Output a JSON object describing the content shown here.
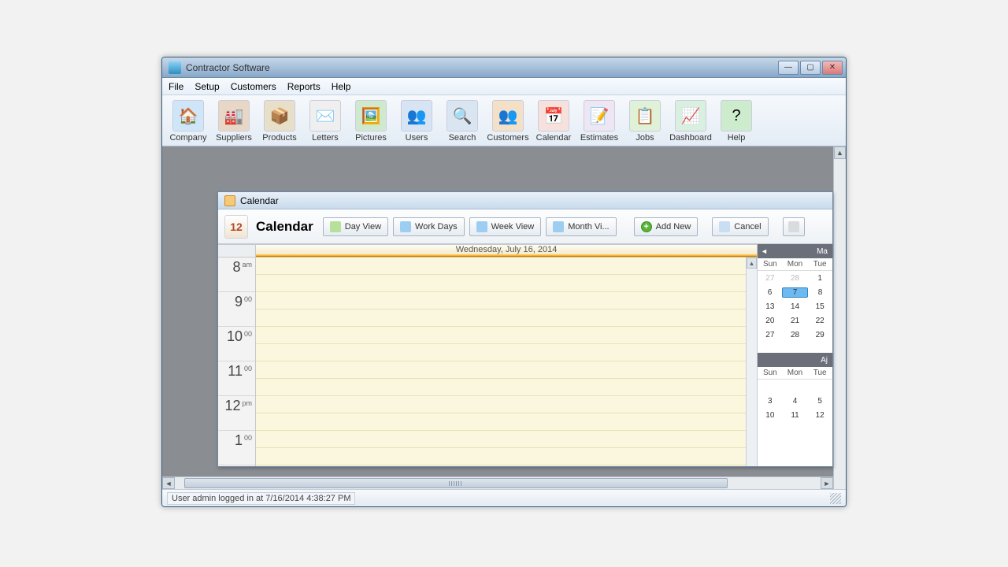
{
  "window": {
    "title": "Contractor Software"
  },
  "menubar": [
    "File",
    "Setup",
    "Customers",
    "Reports",
    "Help"
  ],
  "toolbar": [
    {
      "label": "Company",
      "icon": "house-icon",
      "glyph": "🏠",
      "bg": "#cfe6f9"
    },
    {
      "label": "Suppliers",
      "icon": "factory-icon",
      "glyph": "🏭",
      "bg": "#e9d7c6"
    },
    {
      "label": "Products",
      "icon": "box-icon",
      "glyph": "📦",
      "bg": "#e8dfc9"
    },
    {
      "label": "Letters",
      "icon": "envelope-icon",
      "glyph": "✉️",
      "bg": "#efeff0"
    },
    {
      "label": "Pictures",
      "icon": "photo-icon",
      "glyph": "🖼️",
      "bg": "#cfe9cf"
    },
    {
      "label": "Users",
      "icon": "users-icon",
      "glyph": "👥",
      "bg": "#d6e4f3"
    },
    {
      "label": "Search",
      "icon": "search-icon",
      "glyph": "🔍",
      "bg": "#d9e6f2"
    },
    {
      "label": "Customers",
      "icon": "people-icon",
      "glyph": "👥",
      "bg": "#f4e0c7"
    },
    {
      "label": "Calendar",
      "icon": "calendar-icon",
      "glyph": "📅",
      "bg": "#f7e1dc"
    },
    {
      "label": "Estimates",
      "icon": "estimate-icon",
      "glyph": "📝",
      "bg": "#eee6f2"
    },
    {
      "label": "Jobs",
      "icon": "jobs-icon",
      "glyph": "📋",
      "bg": "#dff2d8"
    },
    {
      "label": "Dashboard",
      "icon": "dashboard-icon",
      "glyph": "📈",
      "bg": "#d9efe0"
    },
    {
      "label": "Help",
      "icon": "help-icon",
      "glyph": "?",
      "bg": "#cdeccd"
    }
  ],
  "child": {
    "title": "Calendar",
    "heading": "Calendar",
    "buttons": {
      "dayview": "Day View",
      "workdays": "Work Days",
      "weekview": "Week View",
      "monthview": "Month Vi...",
      "addnew": "Add New",
      "cancel": "Cancel"
    },
    "dateHeader": "Wednesday, July 16, 2014",
    "hours": [
      {
        "n": "8",
        "s": "am"
      },
      {
        "n": "9",
        "s": "00"
      },
      {
        "n": "10",
        "s": "00"
      },
      {
        "n": "11",
        "s": "00"
      },
      {
        "n": "12",
        "s": "pm"
      },
      {
        "n": "1",
        "s": "00"
      }
    ],
    "minical1": {
      "month_short": "Ma",
      "dow": [
        "Sun",
        "Mon",
        "Tue"
      ],
      "rows": [
        [
          {
            "d": "27",
            "dim": true
          },
          {
            "d": "28",
            "dim": true
          },
          {
            "d": "1"
          }
        ],
        [
          {
            "d": "6"
          },
          {
            "d": "7",
            "sel": true
          },
          {
            "d": "8"
          }
        ],
        [
          {
            "d": "13"
          },
          {
            "d": "14"
          },
          {
            "d": "15"
          }
        ],
        [
          {
            "d": "20"
          },
          {
            "d": "21"
          },
          {
            "d": "22"
          }
        ],
        [
          {
            "d": "27"
          },
          {
            "d": "28"
          },
          {
            "d": "29"
          }
        ]
      ]
    },
    "minical2": {
      "month_short": "Aj",
      "dow": [
        "Sun",
        "Mon",
        "Tue"
      ],
      "rows": [
        [
          {
            "d": ""
          },
          {
            "d": ""
          },
          {
            "d": ""
          }
        ],
        [
          {
            "d": "3"
          },
          {
            "d": "4"
          },
          {
            "d": "5"
          }
        ],
        [
          {
            "d": "10"
          },
          {
            "d": "11"
          },
          {
            "d": "12"
          }
        ]
      ]
    }
  },
  "statusbar": {
    "text": "User admin logged in at 7/16/2014 4:38:27 PM"
  }
}
